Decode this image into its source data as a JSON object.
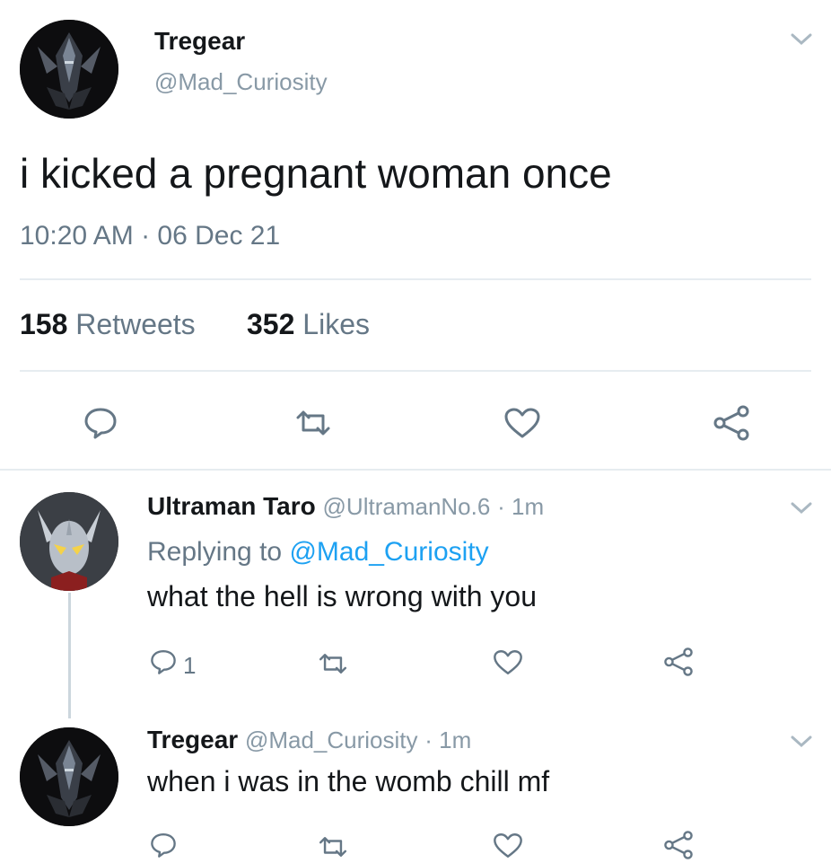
{
  "main_tweet": {
    "author_name": "Tregear",
    "author_handle": "@Mad_Curiosity",
    "text": "i kicked a pregnant woman once",
    "timestamp": "10:20 AM · 06 Dec 21",
    "retweets_count": "158",
    "retweets_label": "Retweets",
    "likes_count": "352",
    "likes_label": "Likes",
    "avatar_icon": "dark-armored-hero-avatar"
  },
  "replies": [
    {
      "author_name": "Ultraman Taro",
      "author_handle": "@UltramanNo.6",
      "time": "· 1m",
      "replying_prefix": "Replying to",
      "replying_to": "@Mad_Curiosity",
      "text": "what the hell is wrong with you",
      "reply_count": "1",
      "avatar_icon": "silver-horned-hero-avatar"
    },
    {
      "author_name": "Tregear",
      "author_handle": "@Mad_Curiosity",
      "time": "· 1m",
      "text": "when i was in the womb chill mf",
      "avatar_icon": "dark-armored-hero-avatar"
    }
  ],
  "colors": {
    "link": "#1da1f2",
    "muted": "#657786",
    "divider": "#e6ecf0",
    "icon": "#657786"
  }
}
